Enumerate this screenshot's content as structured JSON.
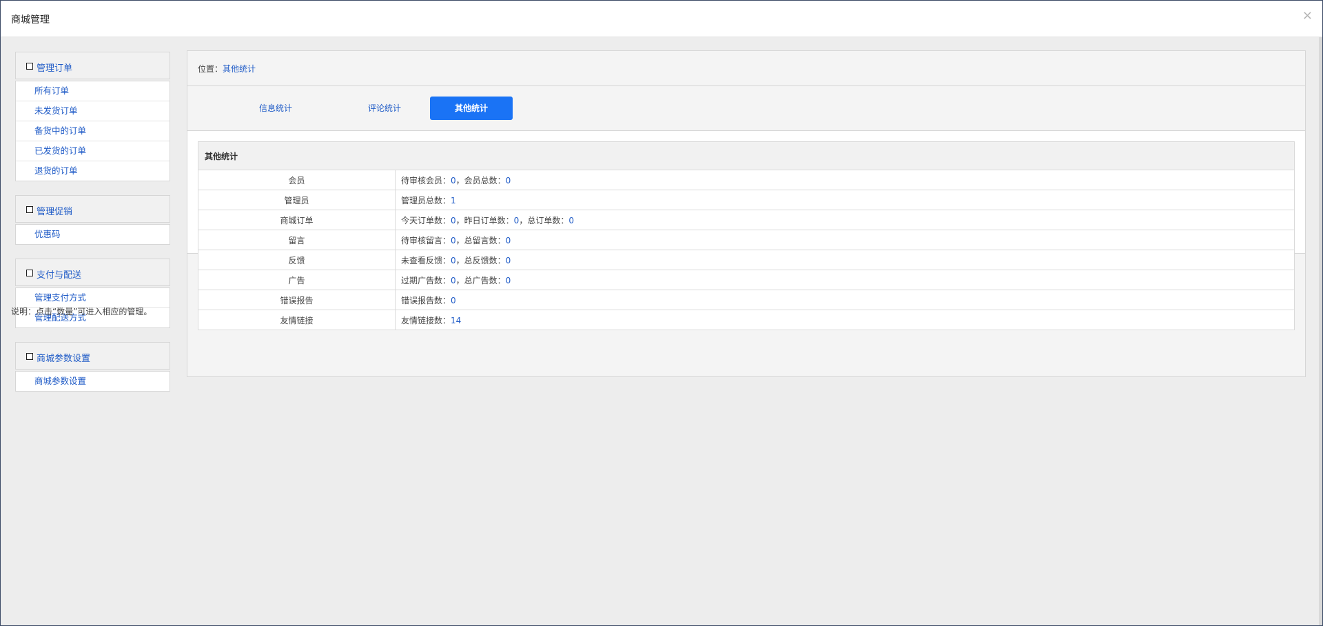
{
  "window": {
    "title": "商城管理",
    "close_glyph": "×"
  },
  "sidebar": {
    "groups": [
      {
        "title": "管理订单",
        "items": [
          "所有订单",
          "未发货订单",
          "备货中的订单",
          "已发货的订单",
          "退货的订单"
        ]
      },
      {
        "title": "管理促销",
        "items": [
          "优惠码"
        ]
      },
      {
        "title": "支付与配送",
        "items": [
          "管理支付方式",
          "管理配送方式"
        ]
      },
      {
        "title": "商城参数设置",
        "items": [
          "商城参数设置"
        ]
      }
    ]
  },
  "breadcrumb": {
    "prefix": "位置：",
    "current": "其他统计"
  },
  "tabs": [
    {
      "label": "信息统计",
      "active": false
    },
    {
      "label": "评论统计",
      "active": false
    },
    {
      "label": "其他统计",
      "active": true
    }
  ],
  "stats": {
    "title": "其他统计",
    "rows": [
      {
        "name": "会员",
        "parts": [
          {
            "label": "待审核会员：",
            "value": "0"
          },
          {
            "label": "，会员总数：",
            "value": "0"
          }
        ]
      },
      {
        "name": "管理员",
        "parts": [
          {
            "label": "管理员总数：",
            "value": "1"
          }
        ]
      },
      {
        "name": "商城订单",
        "parts": [
          {
            "label": "今天订单数：",
            "value": "0"
          },
          {
            "label": "，昨日订单数：",
            "value": "0"
          },
          {
            "label": "，总订单数：",
            "value": "0"
          }
        ]
      },
      {
        "name": "留言",
        "parts": [
          {
            "label": "待审核留言：",
            "value": "0"
          },
          {
            "label": "，总留言数：",
            "value": "0"
          }
        ]
      },
      {
        "name": "反馈",
        "parts": [
          {
            "label": "未查看反馈：",
            "value": "0"
          },
          {
            "label": "，总反馈数：",
            "value": "0"
          }
        ]
      },
      {
        "name": "广告",
        "parts": [
          {
            "label": "过期广告数：",
            "value": "0"
          },
          {
            "label": "，总广告数：",
            "value": "0"
          }
        ]
      },
      {
        "name": "错误报告",
        "parts": [
          {
            "label": "错误报告数：",
            "value": "0"
          }
        ]
      },
      {
        "name": "友情链接",
        "parts": [
          {
            "label": "友情链接数：",
            "value": "14"
          }
        ]
      }
    ]
  },
  "note": "说明：点击“数量”可进入相应的管理。",
  "colors": {
    "accent": "#1a73f5",
    "link": "#1f5bc7",
    "window_border": "#3b4a66"
  }
}
